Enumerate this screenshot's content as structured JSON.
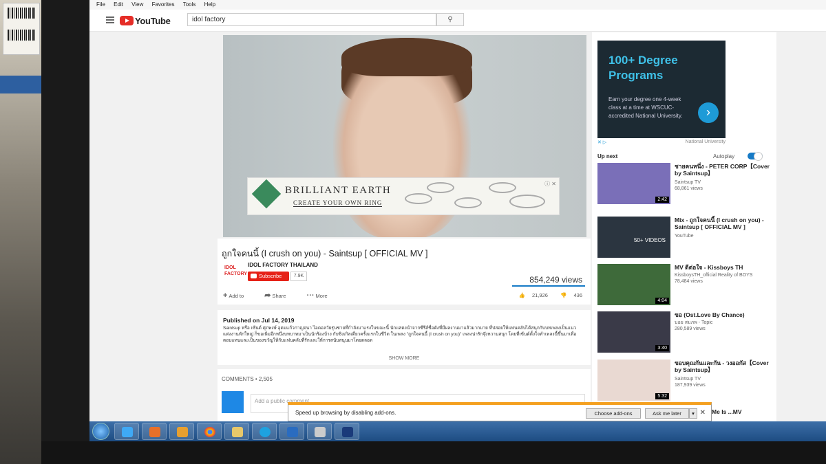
{
  "browser": {
    "menu": [
      "File",
      "Edit",
      "View",
      "Favorites",
      "Tools",
      "Help"
    ]
  },
  "youtube": {
    "logo_text": "YouTube",
    "search_value": "idol factory"
  },
  "player": {
    "ad": {
      "brand": "BRILLIANT EARTH",
      "tagline": "CREATE YOUR OWN RING",
      "close": "ⓘ ✕"
    }
  },
  "video": {
    "title": "ถูกใจคนนี้ (I crush on you) - Saintsup [ OFFICIAL MV ]",
    "channel_logo": "IDOL FACTORY",
    "channel": "IDOL FACTORY THAILAND",
    "subscribe": "Subscribe",
    "subscribers": "7.9K",
    "views": "854,249 views",
    "add_to": "Add to",
    "share": "Share",
    "more": "More",
    "likes": "21,926",
    "dislikes": "436"
  },
  "description": {
    "published": "Published on Jul 14, 2019",
    "text": "Saintsup หรือ เซ้นต์ ศุภพงษ์ อุดมแก้วกาญจนา ไอดอลวัยรุ่นชายที่กำลังมาแรงในขณะนี้ นักแสดงนำจากซีรีส์ชื่อดังที่มีผลงานมาแล้วมากมาย ที่ปล่อยให้แฟนคลับได้สนุกกับบทเพลงเป็นแนวแต่งงานพักใหญ่ ก็ขอเพิ่มอีกหนึ่งบทบาทมาเป็นนักร้องบ้าง กับซิงเกิลเดี่ยวครั้งแรกในชีวิต ในเพลง \"ถูกใจคนนี้ (I crush on you)\" เพลงน่ารักจุ๊งหวานสนุก โดยที่เซ้นต์ตั้งใจทำเพลงนี้ขึ้นมาเพื่อตอบแทนและเป็นของขวัญให้กับแฟนคลับที่รักและให้การสนับสนุนมาโดยตลอด",
    "show_more": "SHOW MORE"
  },
  "comments": {
    "count_label": "COMMENTS • 2,505",
    "placeholder": "Add a public comment..."
  },
  "sidebar_ad": {
    "title": "100+ Degree Programs",
    "body": "Earn your degree one 4-week class at a time at WSCUC-accredited National University.",
    "arrow": "›",
    "adchoices": "✕ ▷",
    "advertiser": "National University"
  },
  "upnext": {
    "label": "Up next",
    "autoplay": "Autoplay",
    "videos": [
      {
        "title": "ชายคนหนึ่ง - PETER CORP【Cover by Saintsup】",
        "channel": "Saintsup TV",
        "meta": "68,861 views",
        "duration": "2:42",
        "color": "#7a6fb8"
      },
      {
        "title": "Mix - ถูกใจคนนี้ (I crush on you) - Saintsup [ OFFICIAL MV ]",
        "channel": "YouTube",
        "meta": "",
        "duration": "50+ VIDEOS",
        "color": "#2b3540"
      },
      {
        "title": "MV ดีต่อใจ - Kissboys TH",
        "channel": "KissboysTH_official Reality of BOYS",
        "meta": "78,484 views",
        "duration": "4:04",
        "color": "#3e6a3a"
      },
      {
        "title": "ขอ (Ost.Love By Chance)",
        "channel": "บอย สมภพ - Topic",
        "meta": "280,589 views",
        "duration": "3:40",
        "color": "#3a3a48"
      },
      {
        "title": "ขอบคุณกันและกัน - วงออกัส【Cover by Saintsup】",
        "channel": "Saintsup TV",
        "meta": "187,939 views",
        "duration": "5:32",
        "color": "#e9d9d2"
      },
      {
        "title": "...ใช่ไหม (Tell Me Is ...MV",
        "channel": "",
        "meta": "",
        "duration": "",
        "color": "#555"
      }
    ]
  },
  "notification": {
    "text": "Speed up browsing by disabling add-ons.",
    "choose": "Choose add-ons",
    "ask_later": "Ask me later",
    "dropdown": "▾",
    "close": "✕"
  }
}
